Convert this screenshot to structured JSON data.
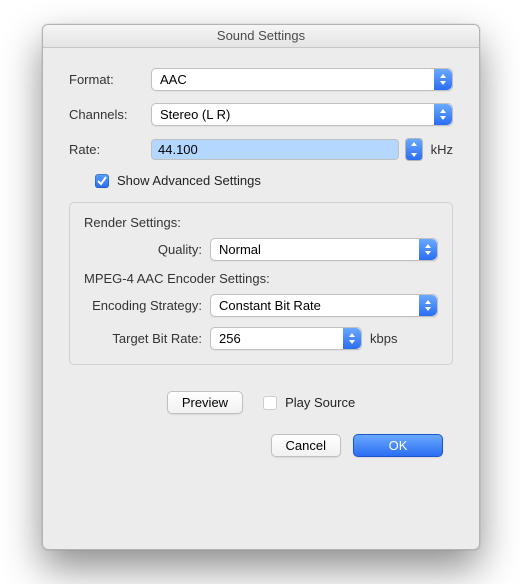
{
  "title": "Sound Settings",
  "labels": {
    "format": "Format:",
    "channels": "Channels:",
    "rate": "Rate:",
    "rate_unit": "kHz",
    "show_advanced": "Show Advanced Settings",
    "render_settings": "Render Settings:",
    "quality": "Quality:",
    "encoder_settings": "MPEG-4 AAC Encoder Settings:",
    "encoding_strategy": "Encoding Strategy:",
    "target_bit_rate": "Target Bit Rate:",
    "kbps": "kbps",
    "preview": "Preview",
    "play_source": "Play Source",
    "cancel": "Cancel",
    "ok": "OK"
  },
  "values": {
    "format": "AAC",
    "channels": "Stereo (L R)",
    "rate": "44.100",
    "show_advanced_checked": true,
    "quality": "Normal",
    "encoding_strategy": "Constant Bit Rate",
    "target_bit_rate": "256",
    "play_source_checked": false
  }
}
